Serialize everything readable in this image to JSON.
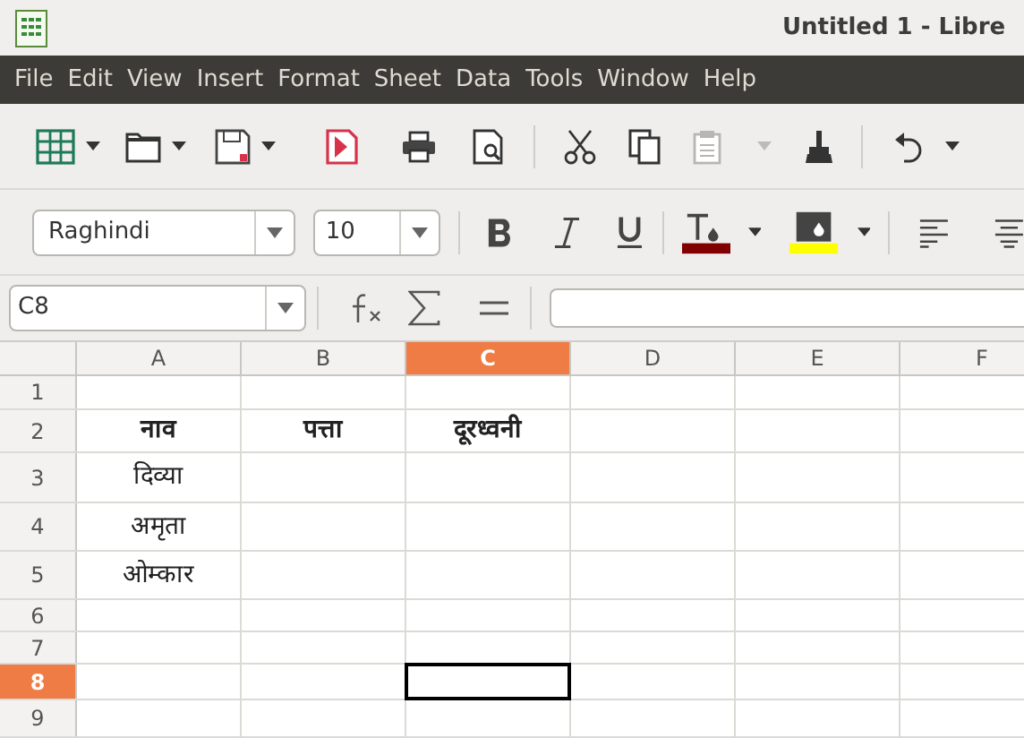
{
  "window": {
    "title": "Untitled 1 - Libre"
  },
  "menu": [
    "File",
    "Edit",
    "View",
    "Insert",
    "Format",
    "Sheet",
    "Data",
    "Tools",
    "Window",
    "Help"
  ],
  "formatting": {
    "font_name": "Raghindi",
    "font_size": "10"
  },
  "formula_bar": {
    "name_box": "C8"
  },
  "columns": [
    {
      "label": "A",
      "selected": false
    },
    {
      "label": "B",
      "selected": false
    },
    {
      "label": "C",
      "selected": true
    },
    {
      "label": "D",
      "selected": false
    },
    {
      "label": "E",
      "selected": false
    },
    {
      "label": "F",
      "selected": false
    }
  ],
  "rows": [
    {
      "label": "1",
      "selected": false
    },
    {
      "label": "2",
      "selected": false,
      "bold": true,
      "cells": [
        "नाव",
        "पत्ता",
        "दूरध्वनी"
      ]
    },
    {
      "label": "3",
      "selected": false,
      "bold": false,
      "cells": [
        "दिव्या"
      ]
    },
    {
      "label": "4",
      "selected": false,
      "bold": false,
      "cells": [
        "अमृता"
      ]
    },
    {
      "label": "5",
      "selected": false,
      "bold": false,
      "cells": [
        "ओम्कार"
      ]
    },
    {
      "label": "6",
      "selected": false
    },
    {
      "label": "7",
      "selected": false
    },
    {
      "label": "8",
      "selected": true
    },
    {
      "label": "9",
      "selected": false
    }
  ]
}
